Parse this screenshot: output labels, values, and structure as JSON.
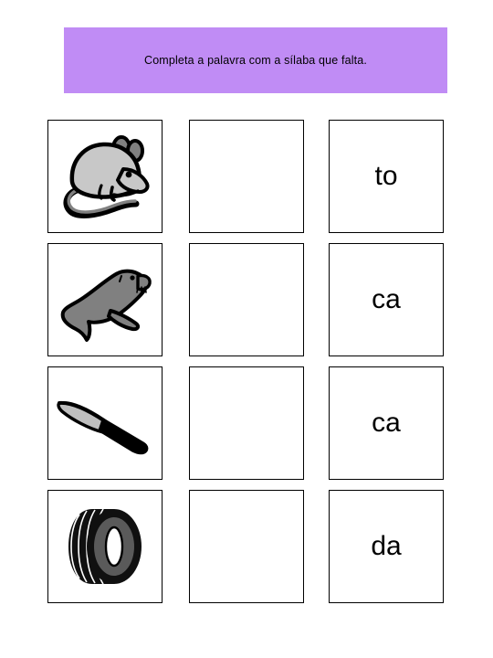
{
  "title": {
    "text": "Completa a palavra com a sílaba que falta.",
    "background_color": "#c08cf5",
    "text_color": "#000000"
  },
  "rows": [
    {
      "picture_name": "mouse-illustration",
      "picture_alt": "rato",
      "blank_cell_value": "",
      "syllable": "to"
    },
    {
      "picture_name": "seal-illustration",
      "picture_alt": "foca",
      "blank_cell_value": "",
      "syllable": "ca"
    },
    {
      "picture_name": "knife-illustration",
      "picture_alt": "faca",
      "blank_cell_value": "",
      "syllable": "ca"
    },
    {
      "picture_name": "tire-illustration",
      "picture_alt": "roda",
      "blank_cell_value": "",
      "syllable": "da"
    }
  ],
  "colors": {
    "page_background": "#ffffff",
    "cell_border": "#000000",
    "mouse_body": "#c8c8c8",
    "mouse_detail": "#808080",
    "seal_body": "#808080",
    "knife_blade": "#bfbfbf",
    "knife_handle": "#000000",
    "tire_tread": "#101010",
    "tire_sidewall": "#5a5a5a",
    "tire_hole": "#ffffff"
  }
}
